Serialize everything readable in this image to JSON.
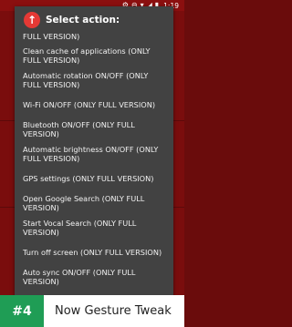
{
  "status_bar": {
    "icons": [
      "settings-icon",
      "minus-circle-icon",
      "wifi-icon",
      "signal-icon",
      "battery-icon"
    ],
    "time": "1:19"
  },
  "dialog": {
    "title": "Select action:",
    "partial_first": "FULL VERSION)",
    "items": [
      {
        "label": "Clean cache of applications (ONLY FULL VERSION)"
      },
      {
        "label": "Automatic rotation ON/OFF (ONLY FULL VERSION)"
      },
      {
        "label": "Wi-Fi ON/OFF (ONLY FULL VERSION)"
      },
      {
        "label": "Bluetooth ON/OFF (ONLY FULL VERSION)"
      },
      {
        "label": "Automatic brightness ON/OFF (ONLY FULL VERSION)"
      },
      {
        "label": "GPS settings (ONLY FULL VERSION)"
      },
      {
        "label": "Open Google Search (ONLY FULL VERSION)"
      },
      {
        "label": "Start Vocal Search (ONLY FULL VERSION)"
      },
      {
        "label": "Turn off screen (ONLY FULL VERSION)"
      },
      {
        "label": "Auto sync ON/OFF (ONLY FULL VERSION)"
      }
    ]
  },
  "banner": {
    "rank": "#4",
    "app_name": "Now Gesture Tweak"
  },
  "colors": {
    "badge": "#1f9d55",
    "dialog_bg": "#424242",
    "header_icon": "#e53935",
    "app_bg": "#7a0d0d"
  }
}
